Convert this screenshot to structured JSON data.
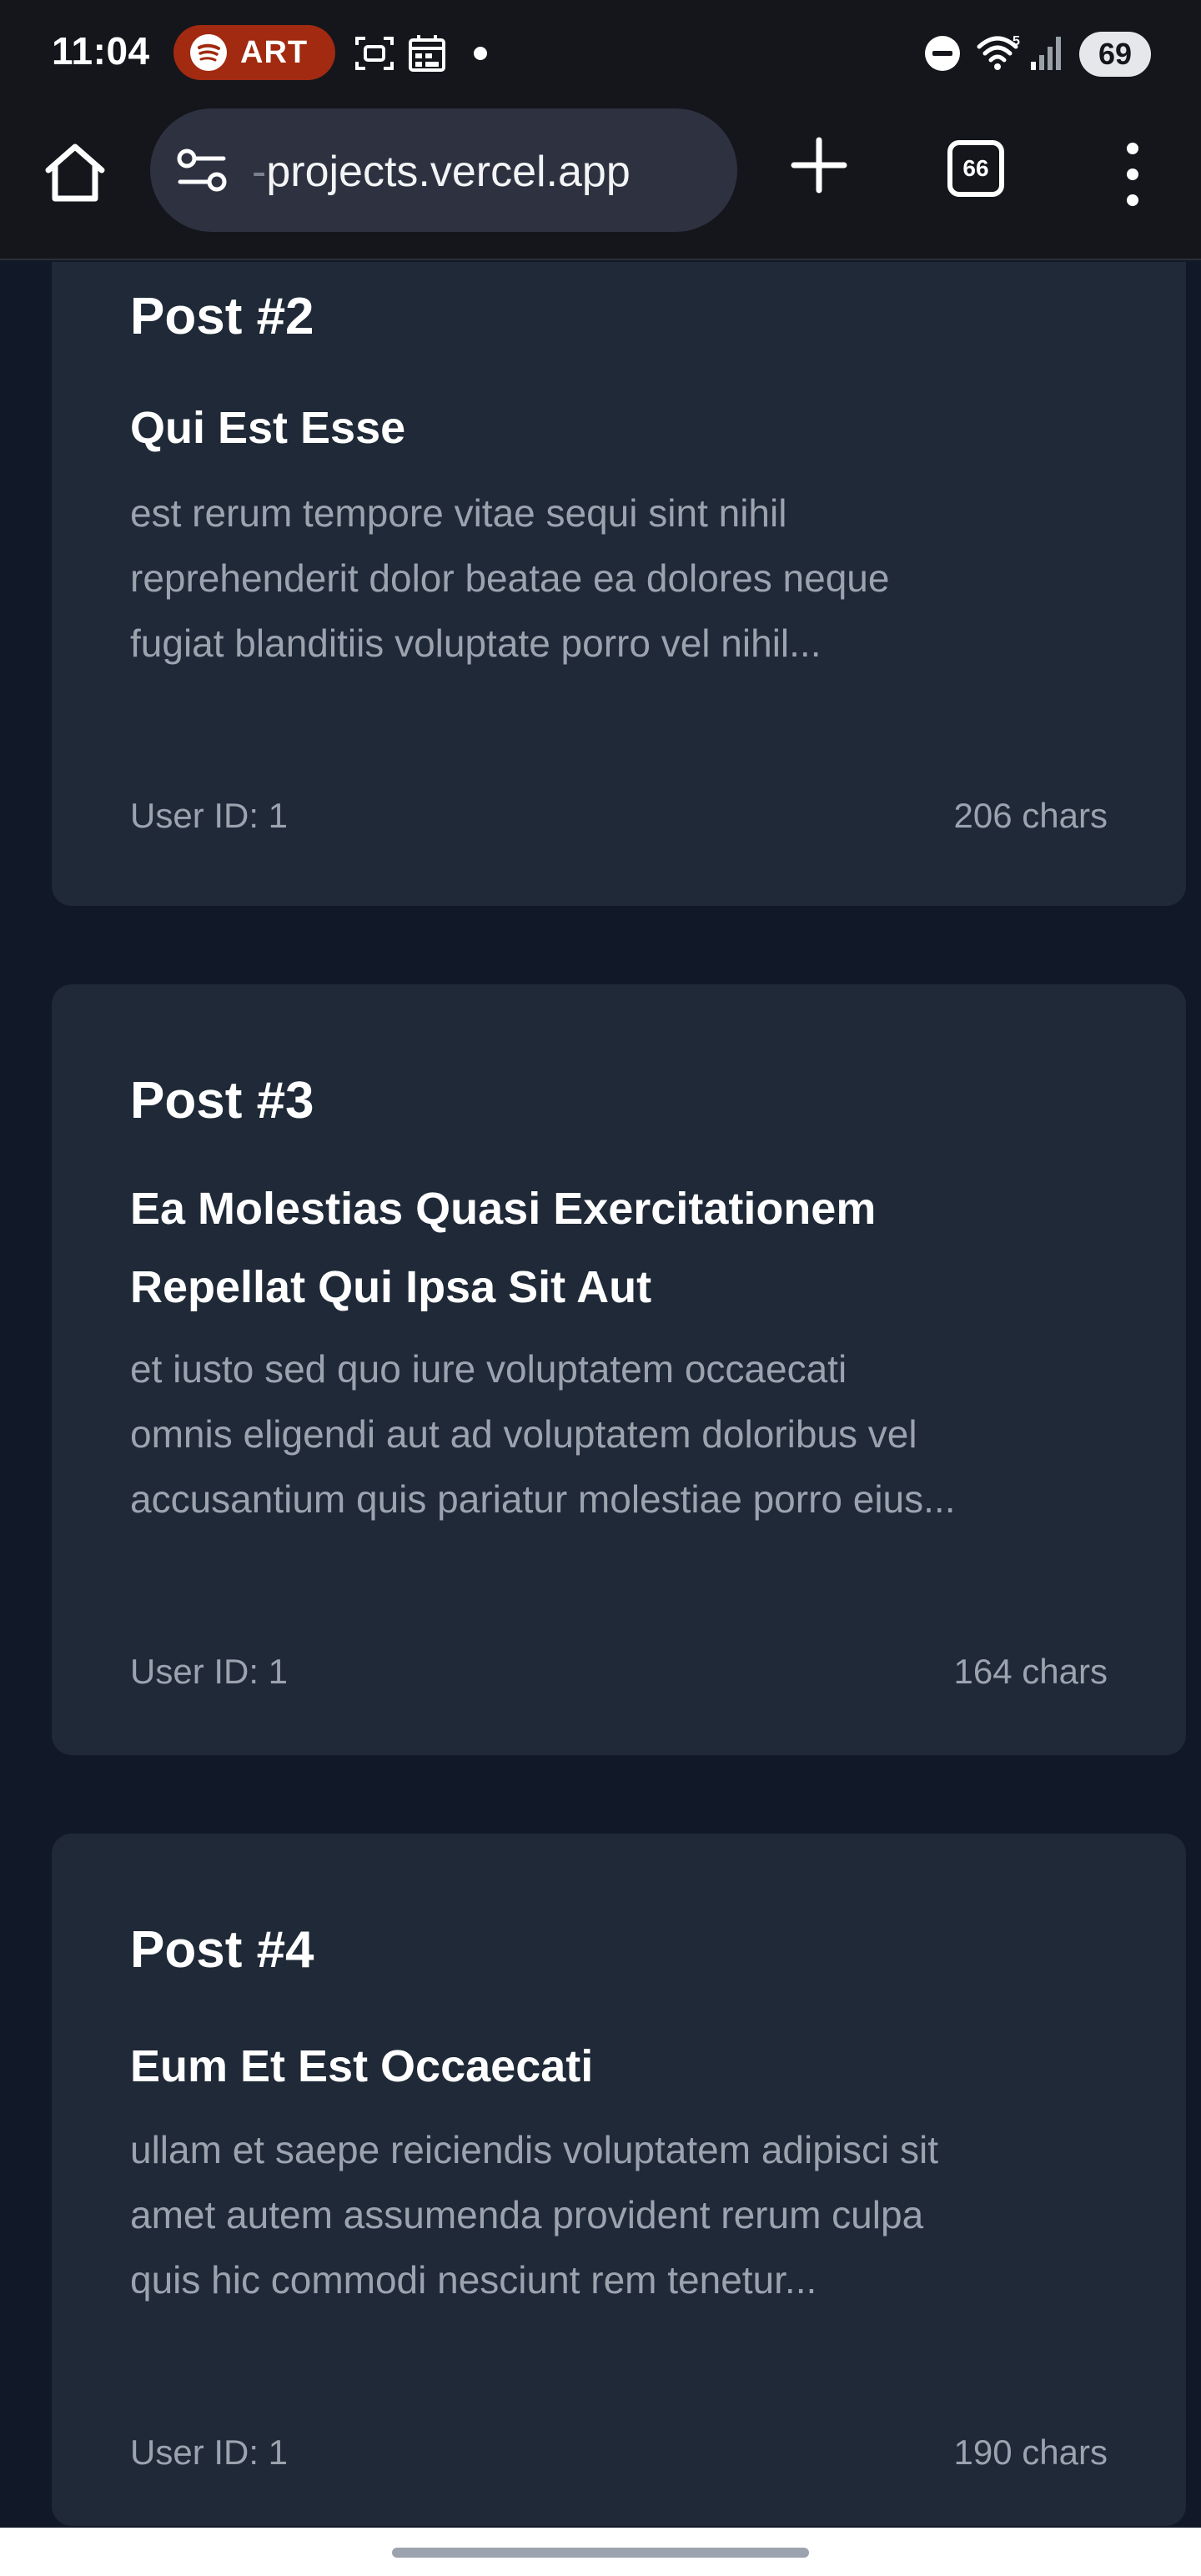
{
  "status_bar": {
    "time": "11:04",
    "media_badge": "ART",
    "battery": "69"
  },
  "browser": {
    "url_prefix": "-",
    "url": "projects.vercel.app",
    "tab_count": "66"
  },
  "posts": [
    {
      "heading": "Post #2",
      "title": "Qui Est Esse",
      "body_lines": [
        "est rerum tempore vitae sequi sint nihil",
        "reprehenderit dolor beatae ea dolores neque",
        "fugiat blanditiis voluptate porro vel nihil..."
      ],
      "user": "User ID: 1",
      "chars": "206 chars"
    },
    {
      "heading": "Post #3",
      "title_lines": [
        "Ea Molestias Quasi Exercitationem",
        "Repellat Qui Ipsa Sit Aut"
      ],
      "body_lines": [
        "et iusto sed quo iure voluptatem occaecati",
        "omnis eligendi aut ad voluptatem doloribus vel",
        "accusantium quis pariatur molestiae porro eius..."
      ],
      "user": "User ID: 1",
      "chars": "164 chars"
    },
    {
      "heading": "Post #4",
      "title": "Eum Et Est Occaecati",
      "body_lines": [
        "ullam et saepe reiciendis voluptatem adipisci sit",
        "amet autem assumenda provident rerum culpa",
        "quis hic commodi nesciunt rem tenetur..."
      ],
      "user": "User ID: 1",
      "chars": "190 chars"
    }
  ]
}
